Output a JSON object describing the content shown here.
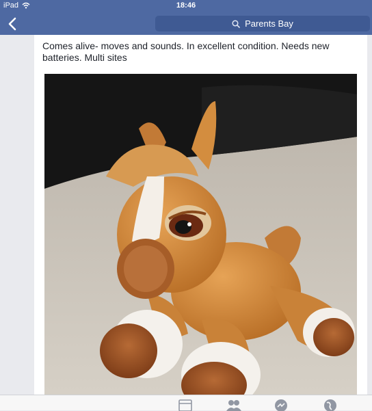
{
  "status_bar": {
    "device": "iPad",
    "time": "18:46",
    "wifi_icon": "wifi-icon"
  },
  "nav": {
    "back_icon": "chevron-left-icon",
    "search_icon": "search-icon",
    "search_label": "Parents Bay"
  },
  "post": {
    "text": "Comes alive- moves and sounds. In excellent condition. Needs new batteries. Multi sites",
    "photo_alt": "Plush horse toy"
  },
  "tab_bar": {
    "tabs": [
      {
        "name": "news-feed",
        "icon": "news-feed-icon"
      },
      {
        "name": "friend-requests",
        "icon": "friends-icon"
      },
      {
        "name": "messages",
        "icon": "messenger-icon"
      },
      {
        "name": "notifications",
        "icon": "globe-icon"
      }
    ]
  },
  "colors": {
    "brand": "#4e69a2",
    "search_bg": "#3f5a93",
    "page_bg": "#e9eaee",
    "toy_orange": "#d58a3a"
  }
}
